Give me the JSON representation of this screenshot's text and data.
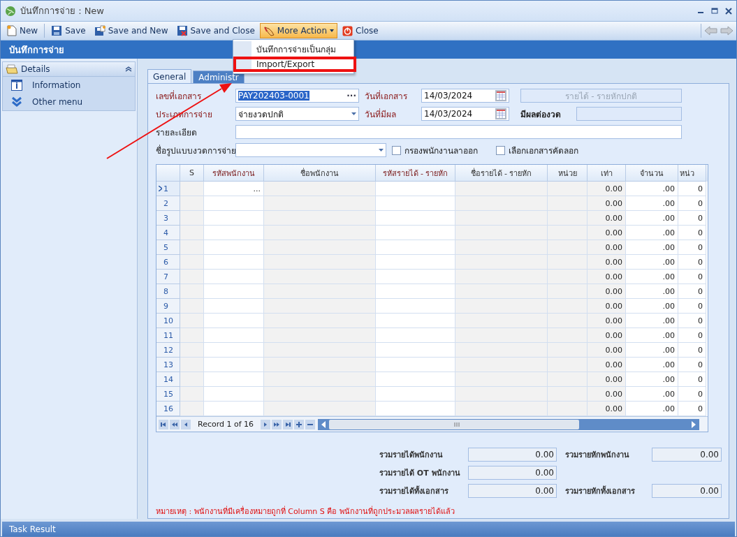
{
  "window": {
    "title": "บันทึกการจ่าย : New"
  },
  "toolbar": {
    "buttons": [
      {
        "label": "New",
        "kind": "new",
        "pressed": false
      },
      {
        "label": "Save",
        "kind": "save",
        "pressed": false
      },
      {
        "label": "Save and New",
        "kind": "save_new",
        "pressed": false
      },
      {
        "label": "Save and Close",
        "kind": "save_close",
        "pressed": false
      },
      {
        "label": "More Action",
        "kind": "more",
        "pressed": true
      },
      {
        "label": "Close",
        "kind": "close",
        "pressed": false
      }
    ]
  },
  "menu": {
    "items": [
      {
        "label": "บันทึกการจ่ายเป็นกลุ่ม",
        "annotated": false
      },
      {
        "label": "Import/Export",
        "annotated": true
      }
    ]
  },
  "header": {
    "title": "บันทึกการจ่าย"
  },
  "sidebar": {
    "title": "Details",
    "expanded": true,
    "items": [
      {
        "label": "Information",
        "kind": "info"
      },
      {
        "label": "Other menu",
        "kind": "more"
      }
    ]
  },
  "tabs": [
    {
      "label": "General",
      "selected": true
    },
    {
      "label": "Administr",
      "selected": false
    }
  ],
  "form": {
    "doc_no": {
      "label": "เลขที่เอกสาร",
      "required": true,
      "value": "PAY202403-0001",
      "text_selected": true,
      "button": "···"
    },
    "doc_date": {
      "label": "วันที่เอกสาร",
      "required": true,
      "value": "14/03/2024"
    },
    "income_kind": {
      "value": "รายได้ - รายหักปกติ",
      "disabled": true
    },
    "pay_type": {
      "label": "ประเภทการจ่าย",
      "required": true,
      "value": "จ่ายงวดปกติ"
    },
    "effective_date": {
      "label": "วันที่มีผล",
      "required": true,
      "value": "14/03/2024"
    },
    "period": {
      "label": "มีผลต่องวด",
      "required": false,
      "disabled": true
    },
    "detail": {
      "label": "รายละเอียด",
      "required": false
    },
    "template": {
      "label": "ชื่อรูปแบบงวดการจ่าย",
      "required": false
    },
    "checkboxes": [
      {
        "label": "กรองพนักงานลาออก",
        "checked": false
      },
      {
        "label": "เลือกเอกสารคัดลอก",
        "checked": false
      }
    ]
  },
  "grid": {
    "columns": [
      {
        "label": "S",
        "required": false
      },
      {
        "label": "รหัสพนักงาน",
        "required": true
      },
      {
        "label": "ชื่อพนักงาน",
        "required": false
      },
      {
        "label": "รหัสรายได้ - รายหัก",
        "required": true
      },
      {
        "label": "ชื่อรายได้ - รายหัก",
        "required": false
      },
      {
        "label": "หน่วย",
        "required": false
      },
      {
        "label": "เท่า",
        "required": false
      },
      {
        "label": "จำนวน",
        "required": false
      },
      {
        "label": "หน่ว",
        "required": false
      }
    ],
    "rows": [
      {
        "number": "1",
        "current": true,
        "emp_code": "...",
        "multiplier": "0.00",
        "amount": ".00",
        "column_10": "0"
      },
      {
        "number": "2",
        "current": false,
        "multiplier": "0.00",
        "amount": ".00",
        "column_10": "0"
      },
      {
        "number": "3",
        "current": false,
        "multiplier": "0.00",
        "amount": ".00",
        "column_10": "0"
      },
      {
        "number": "4",
        "current": false,
        "multiplier": "0.00",
        "amount": ".00",
        "column_10": "0"
      },
      {
        "number": "5",
        "current": false,
        "multiplier": "0.00",
        "amount": ".00",
        "column_10": "0"
      },
      {
        "number": "6",
        "current": false,
        "multiplier": "0.00",
        "amount": ".00",
        "column_10": "0"
      },
      {
        "number": "7",
        "current": false,
        "multiplier": "0.00",
        "amount": ".00",
        "column_10": "0"
      },
      {
        "number": "8",
        "current": false,
        "multiplier": "0.00",
        "amount": ".00",
        "column_10": "0"
      },
      {
        "number": "9",
        "current": false,
        "multiplier": "0.00",
        "amount": ".00",
        "column_10": "0"
      },
      {
        "number": "10",
        "current": false,
        "multiplier": "0.00",
        "amount": ".00",
        "column_10": "0"
      },
      {
        "number": "11",
        "current": false,
        "multiplier": "0.00",
        "amount": ".00",
        "column_10": "0"
      },
      {
        "number": "12",
        "current": false,
        "multiplier": "0.00",
        "amount": ".00",
        "column_10": "0"
      },
      {
        "number": "13",
        "current": false,
        "multiplier": "0.00",
        "amount": ".00",
        "column_10": "0"
      },
      {
        "number": "14",
        "current": false,
        "multiplier": "0.00",
        "amount": ".00",
        "column_10": "0"
      },
      {
        "number": "15",
        "current": false,
        "multiplier": "0.00",
        "amount": ".00",
        "column_10": "0"
      },
      {
        "number": "16",
        "current": false,
        "multiplier": "0.00",
        "amount": ".00",
        "column_10": "0"
      }
    ],
    "pager": "Record 1 of 16"
  },
  "summary": [
    {
      "left": {
        "label": "รวมรายได้พนักงาน",
        "value": "0.00"
      },
      "right": {
        "label": "รวมรายหักพนักงาน",
        "value": "0.00"
      }
    },
    {
      "left": {
        "label": "รวมรายได้ OT พนักงาน",
        "value": "0.00"
      }
    },
    {
      "left": {
        "label": "รวมรายได้ทั้งเอกสาร",
        "value": "0.00"
      },
      "right": {
        "label": "รวมรายหักทั้งเอกสาร",
        "value": "0.00"
      }
    }
  ],
  "note": "หมายเหตุ : พนักงานที่มีเครื่องหมายถูกที่ Column S คือ พนักงานที่ถูกประมวลผลรายได้แล้ว",
  "status_bar": {
    "title": "Task Result"
  }
}
